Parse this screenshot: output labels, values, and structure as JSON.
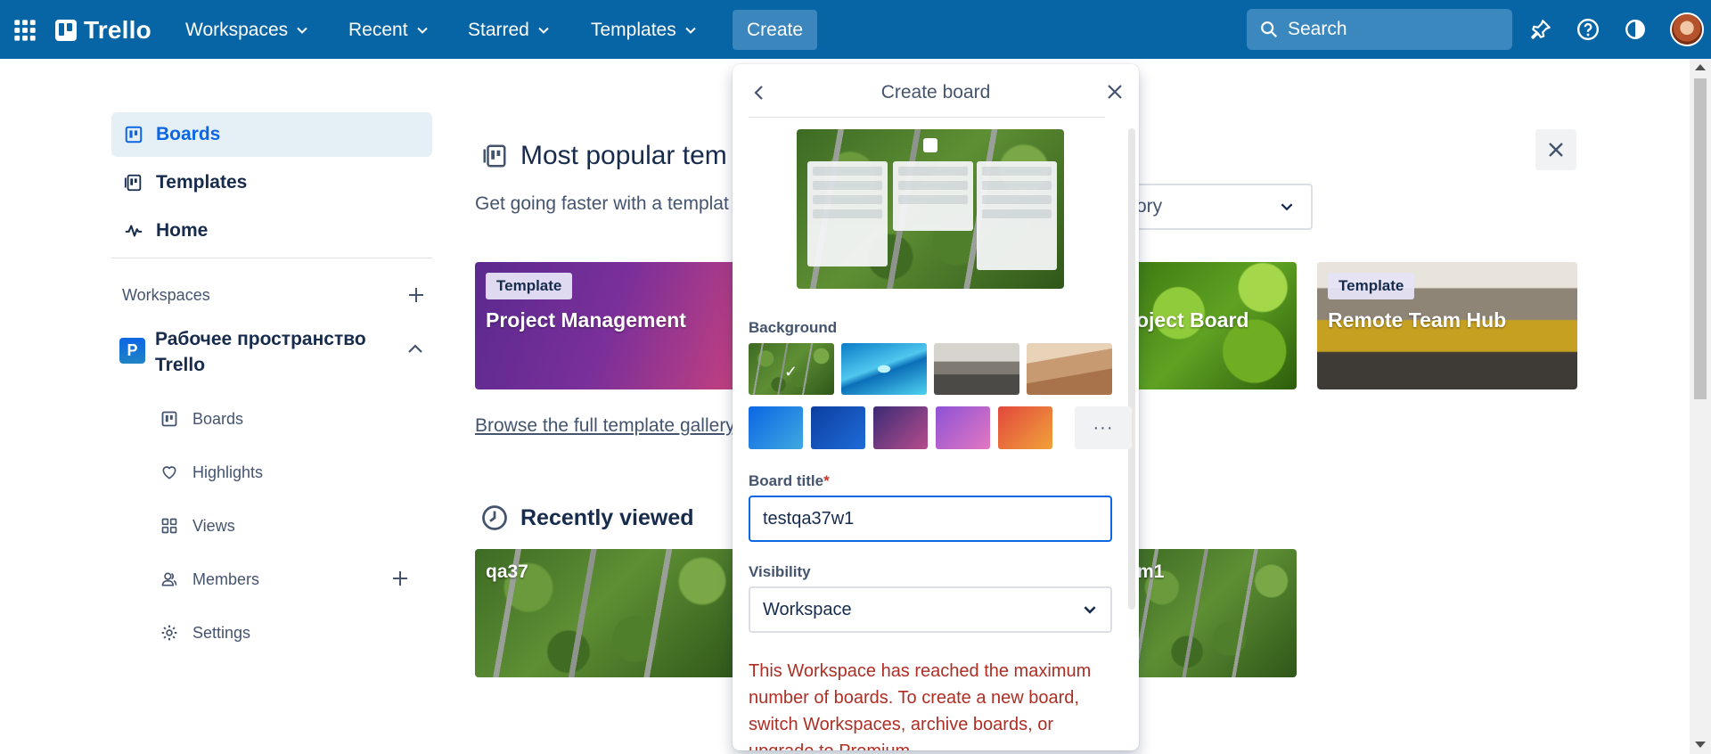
{
  "topbar": {
    "logo": "Trello",
    "nav": [
      "Workspaces",
      "Recent",
      "Starred",
      "Templates"
    ],
    "create": "Create",
    "search_placeholder": "Search",
    "color": "#0765a6"
  },
  "sidebar": {
    "items": [
      {
        "label": "Boards",
        "icon": "board-icon"
      },
      {
        "label": "Templates",
        "icon": "template-icon"
      },
      {
        "label": "Home",
        "icon": "activity-icon"
      }
    ],
    "workspaces_label": "Workspaces",
    "workspace": {
      "badge": "P",
      "name": "Рабочее пространство Trello"
    },
    "sub_items": [
      {
        "label": "Boards",
        "icon": "board-icon"
      },
      {
        "label": "Highlights",
        "icon": "heart-icon"
      },
      {
        "label": "Views",
        "icon": "grid-icon"
      },
      {
        "label": "Members",
        "icon": "members-icon"
      },
      {
        "label": "Settings",
        "icon": "gear-icon"
      }
    ]
  },
  "main": {
    "popular_title": "Most popular tem",
    "popular_sub": "Get going faster with a templat",
    "category_value": "ory",
    "templates": [
      {
        "badge": "Template",
        "title": "Project Management"
      },
      {
        "title": "roject Board"
      },
      {
        "badge": "Template",
        "title": "Remote Team Hub"
      }
    ],
    "browse_link": "Browse the full template gallery",
    "recent_title": "Recently viewed",
    "boards": [
      "qa37",
      "m1"
    ]
  },
  "popover": {
    "title": "Create board",
    "background_label": "Background",
    "colors": [
      "#1f86d6",
      "#0c4fb3",
      "#7a3a8c",
      "#b260c6",
      "#e8612c"
    ],
    "more": "···",
    "board_title_label": "Board title",
    "required_mark": "*",
    "board_title_value": "testqa37w1",
    "visibility_label": "Visibility",
    "visibility_value": "Workspace",
    "warning": "This Workspace has reached the maximum number of boards. To create a new board, switch Workspaces, archive boards, or upgrade to Premium."
  }
}
